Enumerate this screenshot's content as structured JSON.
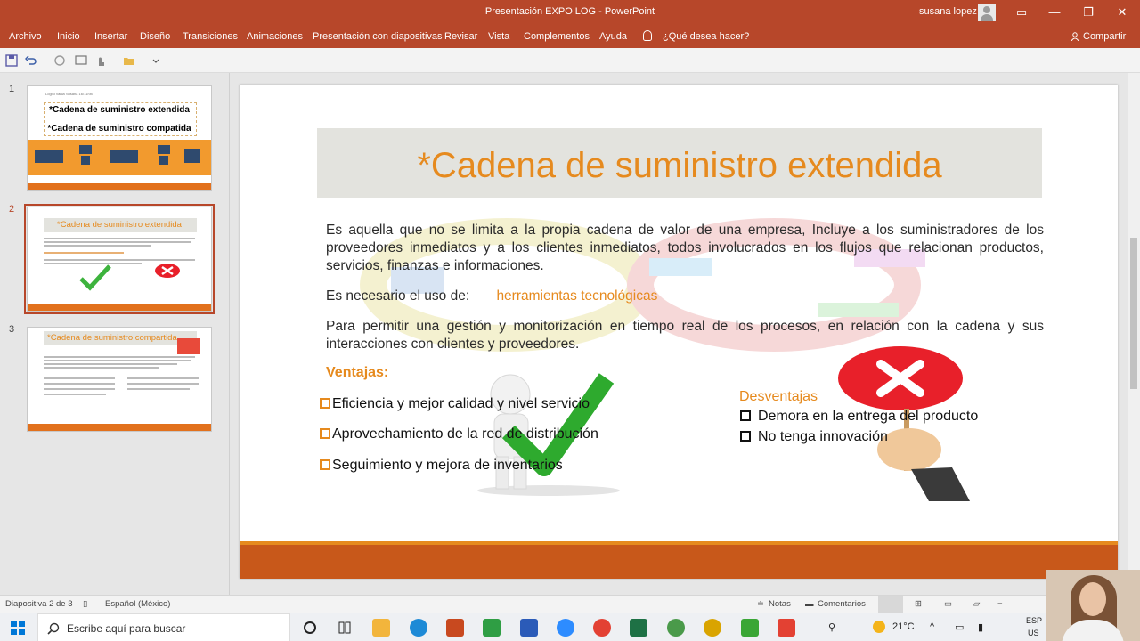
{
  "window": {
    "title": "Presentación EXPO LOG  -  PowerPoint",
    "user": "susana lopez",
    "controls": [
      "▭",
      "—",
      "❐",
      "✕"
    ]
  },
  "ribbon": {
    "tabs": [
      "Archivo",
      "Inicio",
      "Insertar",
      "Diseño",
      "Transiciones",
      "Animaciones",
      "Presentación con diapositivas",
      "Revisar",
      "Vista",
      "Complementos",
      "Ayuda"
    ],
    "tell_me": "¿Qué desea hacer?",
    "share": "Compartir"
  },
  "thumbnails": {
    "numbers": [
      "1",
      "2",
      "3"
    ],
    "slide1": {
      "header_tiny": "Logist Vania Susana 16/11/98",
      "line1": "*Cadena de suministro extendida",
      "line2": "*Cadena de suministro compatida"
    },
    "slide2": {
      "title": "*Cadena de suministro extendida"
    },
    "slide3": {
      "title": "*Cadena de suministro compartida"
    }
  },
  "slide": {
    "title": "*Cadena de suministro extendida",
    "p1": "Es aquella que no se limita a la propia cadena de valor de una empresa, Incluye a los suministradores de los proveedores inmediatos y a los clientes inmediatos, todos involucrados en los flujos que relacionan productos, servicios, finanzas e informaciones.",
    "p2_label": "Es necesario el uso de:",
    "p2_value": "herramientas tecnológicas",
    "p3": "Para permitir una gestión y monitorización en tiempo real de los procesos, en relación con la cadena y sus interacciones con clientes y proveedores.",
    "ventajas_title": "Ventajas:",
    "ventajas": [
      "Eficiencia y mejor calidad y nivel servicio",
      "Aprovechamiento de la red de distribución",
      "Seguimiento y mejora de inventarios"
    ],
    "desventajas_title": "Desventajas",
    "desventajas": [
      "Demora en la entrega del producto",
      "No tenga innovación"
    ]
  },
  "status": {
    "slide_counter": "Diapositiva 2 de 3",
    "language": "Español (México)",
    "notes": "Notas",
    "comments": "Comentarios"
  },
  "taskbar": {
    "search_placeholder": "Escribe aquí para buscar",
    "temperature": "21°C",
    "lang1": "ESP",
    "lang2": "US"
  },
  "colors": {
    "accent": "#b7472a",
    "orange": "#e68a1e",
    "footer": "#c8581a"
  }
}
